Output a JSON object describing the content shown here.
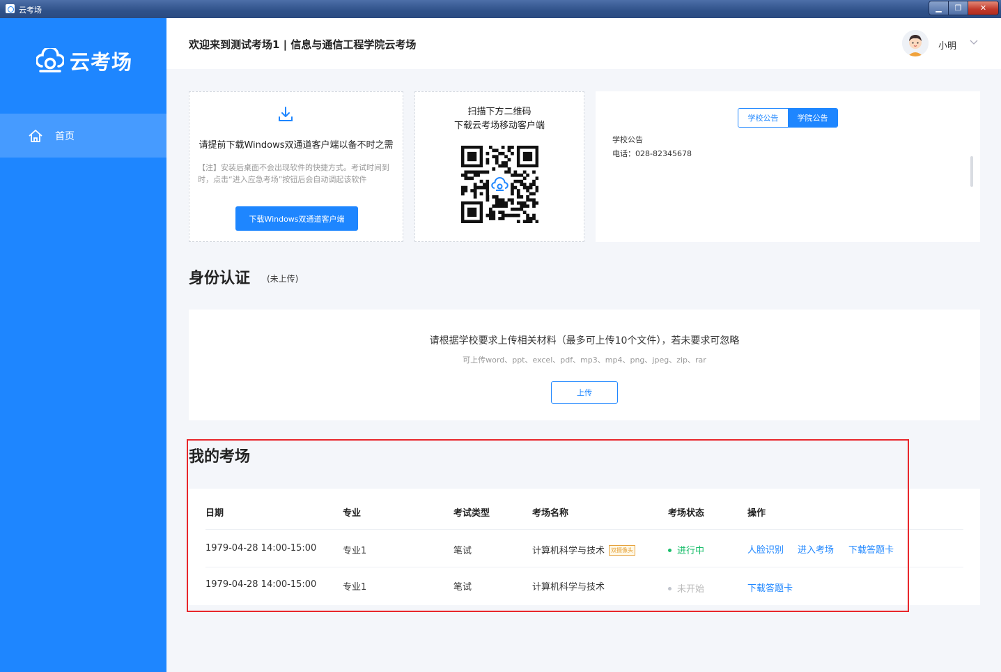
{
  "window": {
    "title": "云考场",
    "min_glyph": "▁",
    "max_glyph": "❐",
    "close_glyph": "✕"
  },
  "sidebar": {
    "brand": "云考场",
    "home_label": "首页"
  },
  "header": {
    "welcome": "欢迎来到测试考场1 | 信息与通信工程学院云考场",
    "username": "小明"
  },
  "download_card": {
    "title": "请提前下载Windows双通道客户端以备不时之需",
    "note": "【注】安装后桌面不会出现软件的快捷方式。考试时间到时，点击“进入应急考场”按钮后会自动调起该软件",
    "button": "下载Windows双通道客户端"
  },
  "qr_card": {
    "line1": "扫描下方二维码",
    "line2": "下载云考场移动客户端"
  },
  "notice_card": {
    "tabs": [
      "学校公告",
      "学院公告"
    ],
    "active_tab": 1,
    "title": "学校公告",
    "phone": "电话：028-82345678"
  },
  "identity": {
    "title": "身份认证",
    "status": "(未上传)",
    "upload_title": "请根据学校要求上传相关材料（最多可上传10个文件），若未要求可忽略",
    "upload_hint": "可上传word、ppt、excel、pdf、mp3、mp4、png、jpeg、zip、rar",
    "upload_button": "上传"
  },
  "exams": {
    "title": "我的考场",
    "headers": [
      "日期",
      "专业",
      "考试类型",
      "考场名称",
      "考场状态",
      "操作"
    ],
    "rows": [
      {
        "date": "1979-04-28  14:00-15:00",
        "major": "专业1",
        "type": "笔试",
        "name": "计算机科学与技术",
        "tag": "双摄像头",
        "status": "进行中",
        "actions": [
          "人脸识别",
          "进入考场",
          "下载答题卡"
        ]
      },
      {
        "date": "1979-04-28  14:00-15:00",
        "major": "专业1",
        "type": "笔试",
        "name": "计算机科学与技术",
        "tag": "",
        "status": "未开始",
        "actions": [
          "下载答题卡"
        ]
      }
    ]
  },
  "colors": {
    "primary": "#1e86ff",
    "live": "#19be6b",
    "highlight": "#e8262b"
  }
}
